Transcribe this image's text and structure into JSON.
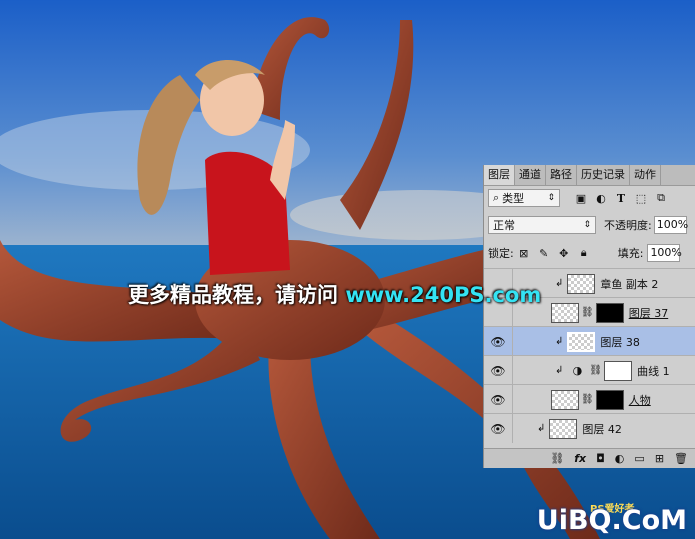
{
  "colors": {
    "sky_top": "#1e63c8",
    "sky_mid": "#4d85cf",
    "sea": "#0f6ab0",
    "octopus": "#8c3b26",
    "panel_bg": "#cfcfcf",
    "selected_layer": "#a9bfe6",
    "banner_url": "#34e3f3"
  },
  "panel": {
    "tabs": [
      "图层",
      "通道",
      "路径",
      "历史记录",
      "动作"
    ],
    "filter_label": "类型",
    "blend_mode": "正常",
    "opacity_label": "不透明度:",
    "opacity_value": "100%",
    "lock_label": "锁定:",
    "fill_label": "填充:",
    "fill_value": "100%",
    "layers": [
      {
        "name": "章鱼 副本 2"
      },
      {
        "name": "图层 37"
      },
      {
        "name": "图层 38"
      },
      {
        "name": "曲线 1"
      },
      {
        "name": "人物"
      },
      {
        "name": "图层 42"
      }
    ]
  },
  "banner": {
    "text": "更多精品教程，请访问",
    "url": "www.240PS.com"
  },
  "watermark": {
    "text": "UiBQ.CoM",
    "small": "PS爱好者"
  }
}
